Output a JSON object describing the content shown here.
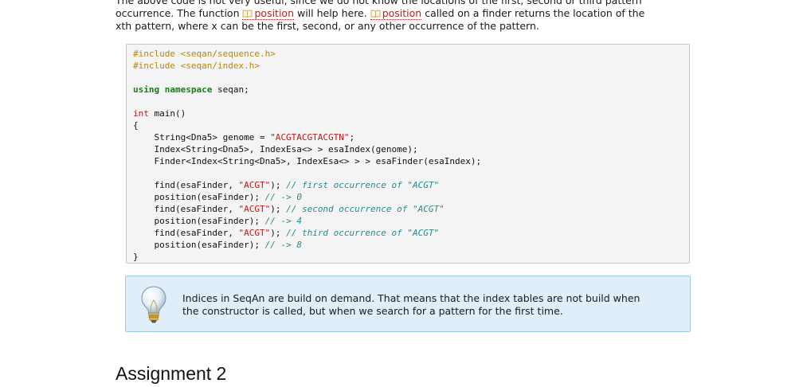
{
  "paragraph": {
    "line1": "The above code is not very useful, since we do not know the locations of the first, second or third pattern",
    "line2_pre": "occurrence. The function ",
    "ref1": "position",
    "line2_mid": " will help here. ",
    "ref2": "position",
    "line2_post": " called on a finder returns the location of the",
    "line3": "xth pattern, where x can be the first, second, or any other occurrence of the pattern."
  },
  "code": {
    "l1_pp": "#include <seqan/sequence.h>",
    "l2_pp": "#include <seqan/index.h>",
    "l4_kw": "using namespace",
    "l4_rest": " seqan;",
    "l6_ty": "int",
    "l6_rest": " main()",
    "l7": "{",
    "l8_a": "    String<Dna5> genome = ",
    "l8_str": "\"ACGTACGTACGTN\"",
    "l8_b": ";",
    "l9": "    Index<String<Dna5>, IndexEsa<> > esaIndex(genome);",
    "l10": "    Finder<Index<String<Dna5>, IndexEsa<> > > esaFinder(esaIndex);",
    "l12_a": "    find(esaFinder, ",
    "l12_str": "\"ACGT\"",
    "l12_b": "); ",
    "l12_cm": "// first occurrence of \"ACGT\"",
    "l13_a": "    position(esaFinder); ",
    "l13_cm": "// -> 0",
    "l14_a": "    find(esaFinder, ",
    "l14_str": "\"ACGT\"",
    "l14_b": "); ",
    "l14_cm": "// second occurrence of \"ACGT\"",
    "l15_a": "    position(esaFinder); ",
    "l15_cm": "// -> 4",
    "l16_a": "    find(esaFinder, ",
    "l16_str": "\"ACGT\"",
    "l16_b": "); ",
    "l16_cm": "// third occurrence of \"ACGT\"",
    "l17_a": "    position(esaFinder); ",
    "l17_cm": "// -> 8",
    "l18": "}"
  },
  "note": {
    "icon": "lightbulb-icon",
    "line1": "Indices in SeqAn are build on demand. That means that the index tables are not build when",
    "line2": "the constructor is called, but when we search for a pattern for the first time."
  },
  "heading": "Assignment 2",
  "colors": {
    "link": "#b22222",
    "preprocessor": "#b8860b",
    "keyword": "#1a7b1a",
    "string": "#c01818",
    "comment": "#2b8a8a",
    "note_background": "#dfeef8",
    "code_background": "#f4f4f4"
  }
}
